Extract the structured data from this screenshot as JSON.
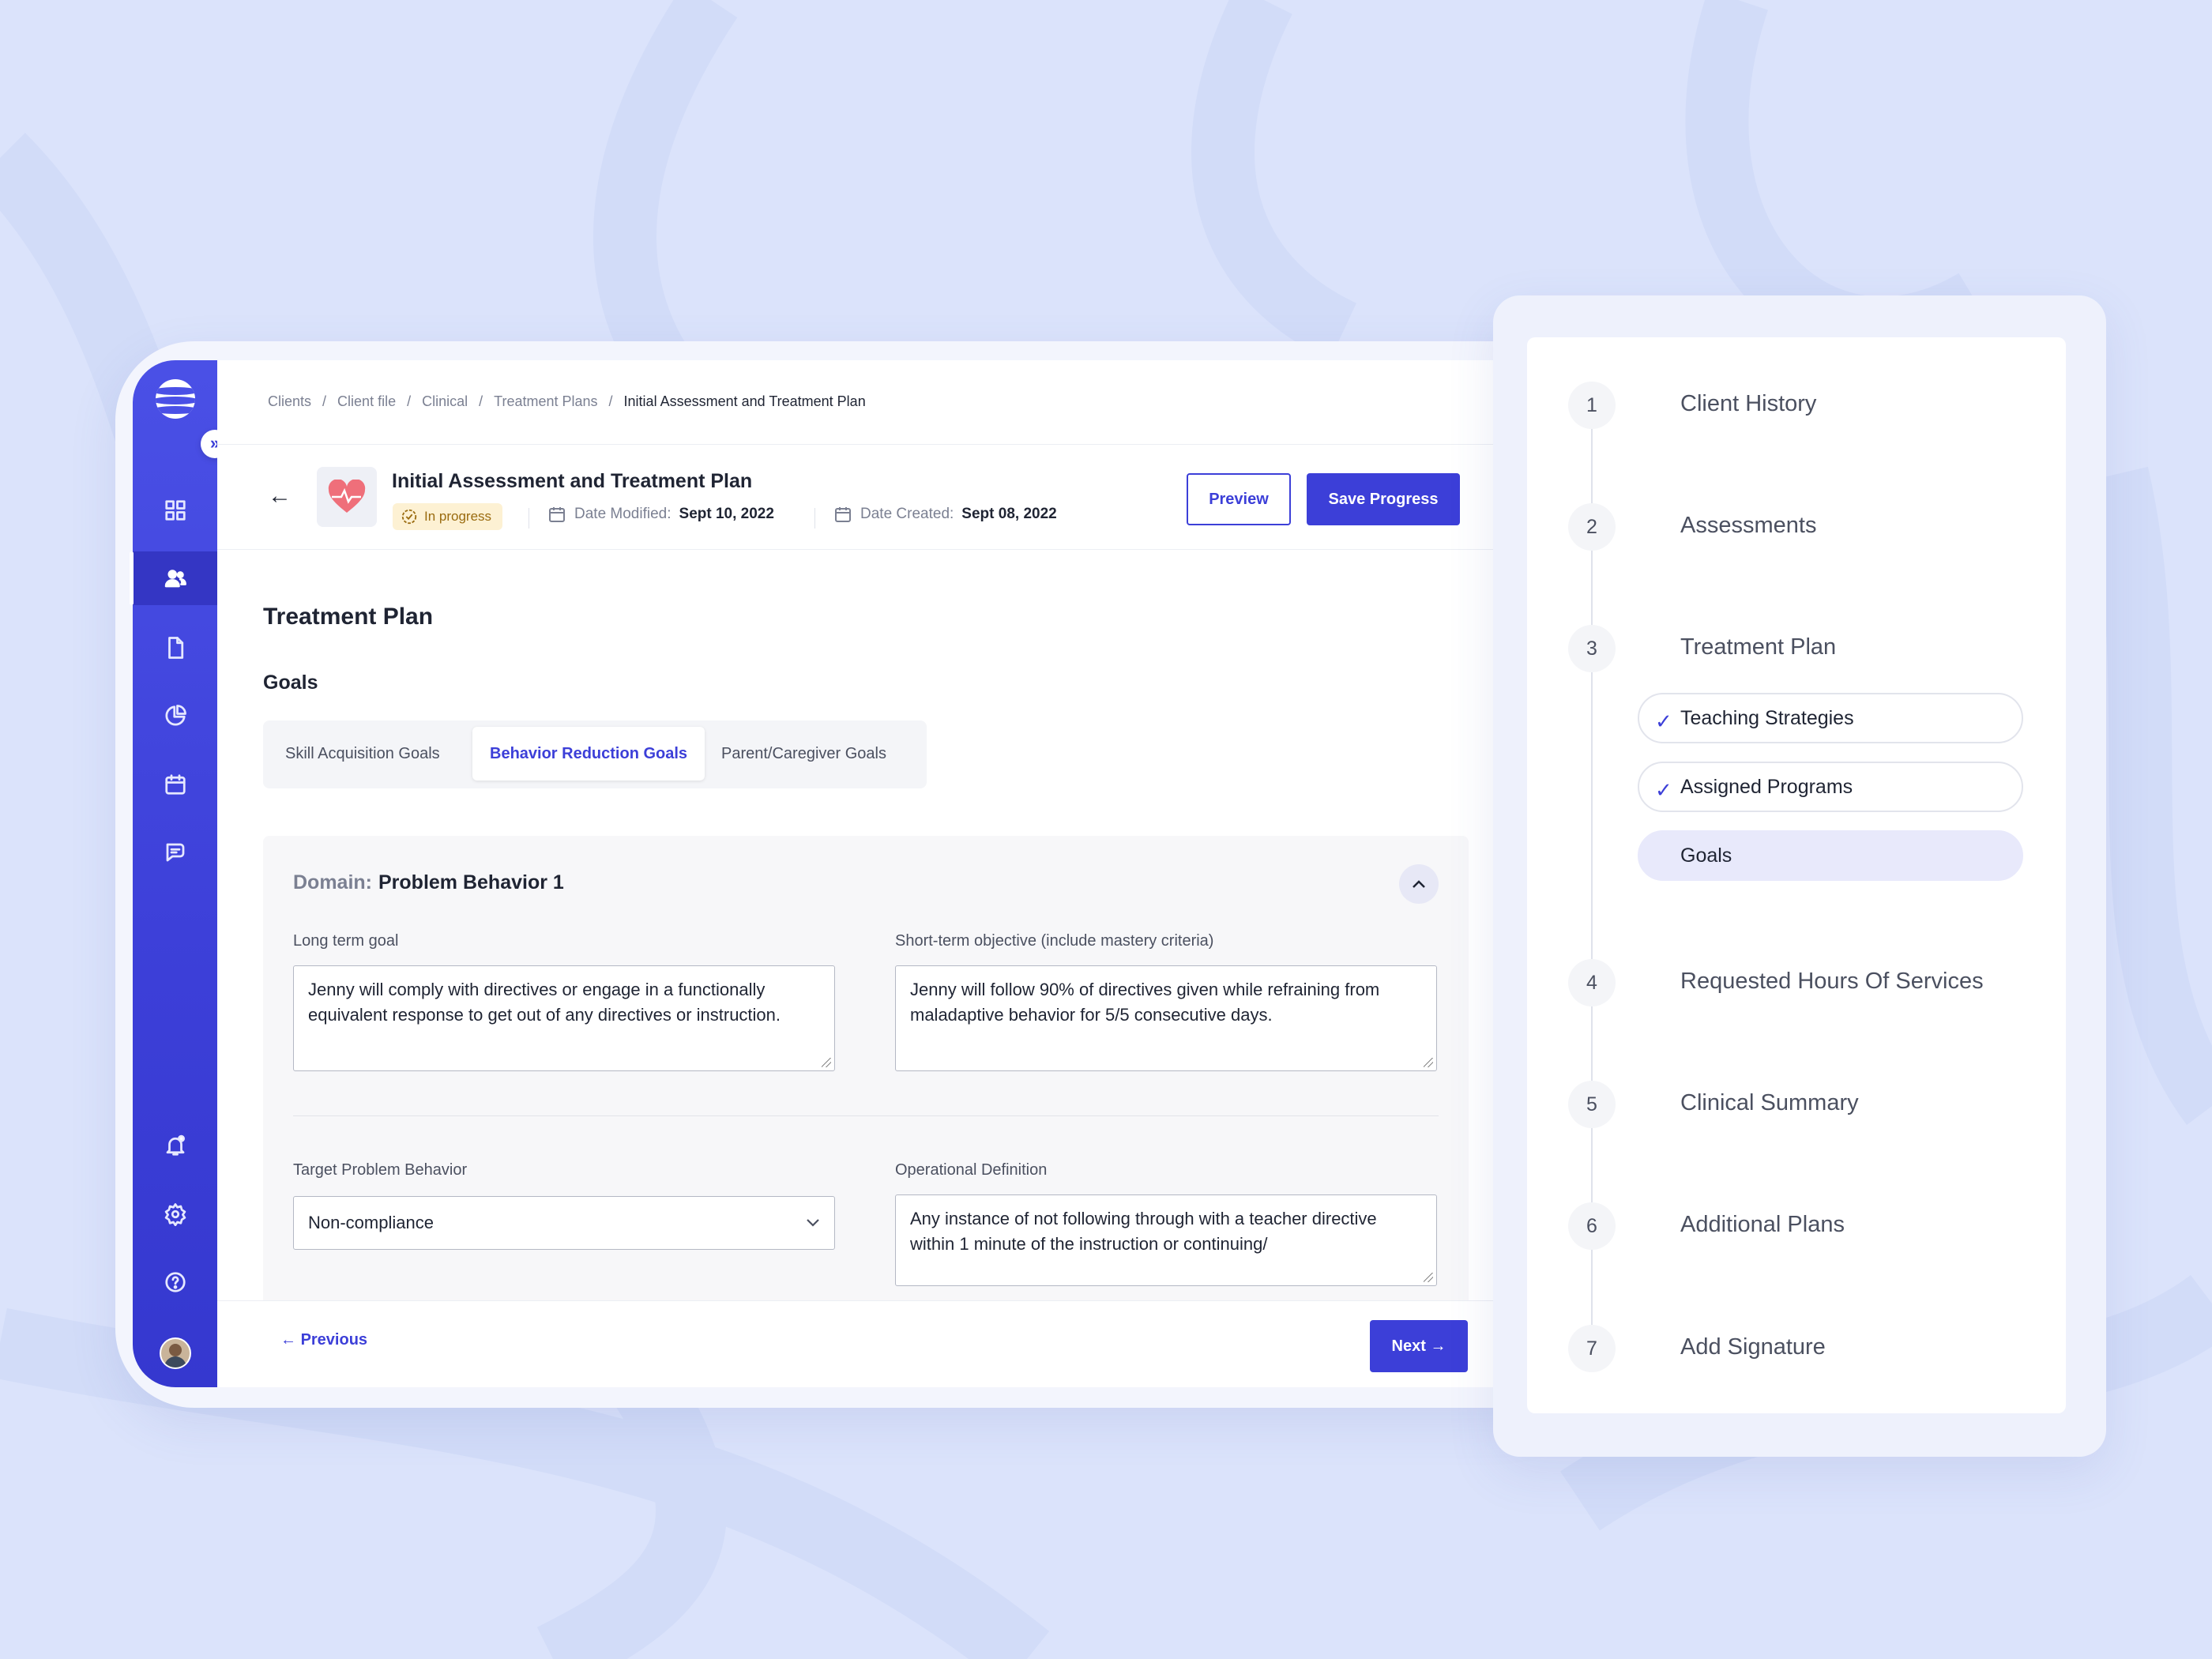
{
  "breadcrumb": [
    "Clients",
    "Client file",
    "Clinical",
    "Treatment Plans",
    "Initial Assessment and Treatment Plan"
  ],
  "header": {
    "title": "Initial Assessment and Treatment Plan",
    "status": "In progress",
    "date_modified_label": "Date Modified:",
    "date_modified": "Sept 10, 2022",
    "date_created_label": "Date Created:",
    "date_created": "Sept 08, 2022",
    "preview_label": "Preview",
    "save_label": "Save Progress"
  },
  "section_title": "Treatment Plan",
  "goals_title": "Goals",
  "tabs": [
    "Skill Acquisition Goals",
    "Behavior Reduction Goals",
    "Parent/Caregiver Goals"
  ],
  "active_tab": "Behavior Reduction Goals",
  "domain": {
    "label": "Domain:",
    "value": "Problem Behavior 1"
  },
  "form": {
    "long_term_label": "Long term goal",
    "long_term_value": "Jenny will comply with directives or engage in a functionally equivalent response to get out of any directives or instruction.",
    "short_term_label": "Short-term objective (include mastery criteria)",
    "short_term_value": "Jenny will follow 90% of directives given while refraining from maladaptive behavior for 5/5 consecutive days.",
    "target_label": "Target Problem Behavior",
    "target_value": "Non-compliance",
    "operational_label": "Operational Definition",
    "operational_value": "Any instance of not following through with a teacher directive within 1 minute of the instruction or continuing/"
  },
  "footer": {
    "previous_label": "Previous",
    "next_label": "Next"
  },
  "stepper": {
    "steps": [
      {
        "num": "1",
        "label": "Client History"
      },
      {
        "num": "2",
        "label": "Assessments"
      },
      {
        "num": "3",
        "label": "Treatment Plan"
      },
      {
        "num": "4",
        "label": "Requested Hours Of Services"
      },
      {
        "num": "5",
        "label": "Clinical Summary"
      },
      {
        "num": "6",
        "label": "Additional Plans"
      },
      {
        "num": "7",
        "label": "Add Signature"
      }
    ],
    "substeps": [
      {
        "label": "Teaching Strategies",
        "done": true
      },
      {
        "label": "Assigned Programs",
        "done": true
      },
      {
        "label": "Goals",
        "done": false,
        "active": true
      }
    ]
  },
  "sidebar": {
    "icons": [
      "dashboard-icon",
      "users-icon",
      "document-icon",
      "pie-chart-icon",
      "calendar-icon",
      "chat-icon",
      "bell-icon",
      "settings-icon",
      "help-icon"
    ],
    "active": "users-icon"
  },
  "colors": {
    "primary": "#3c3fd8",
    "background": "#dbe3fb",
    "badge_bg": "#fdf1d3",
    "badge_text": "#9a6b0f"
  }
}
